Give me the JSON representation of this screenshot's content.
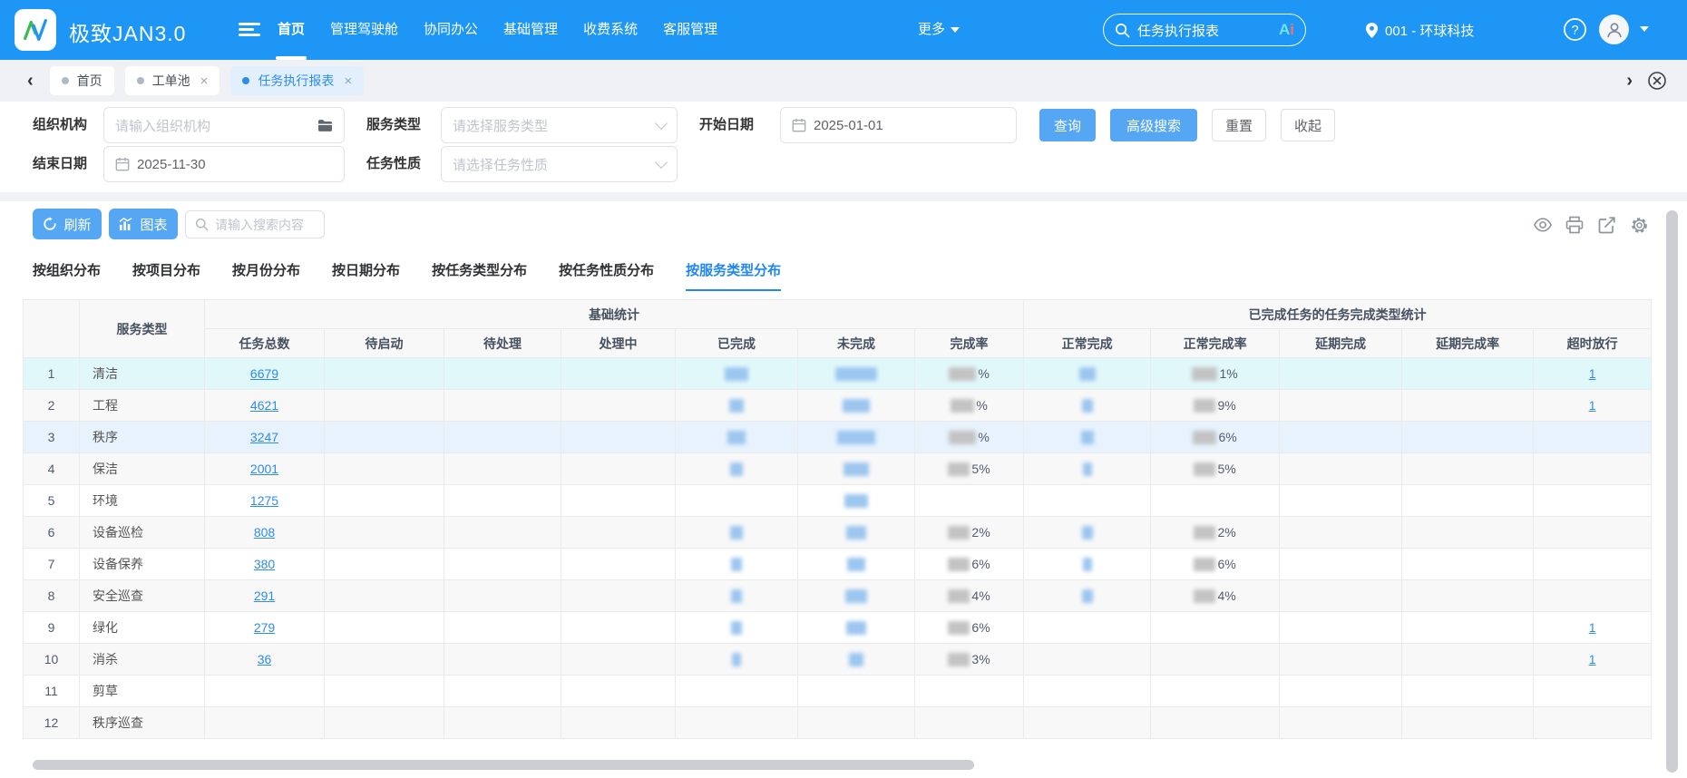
{
  "colors": {
    "header_bg": "#1e96f5",
    "button_blue": "#56a7f3",
    "link": "#2d8cf0",
    "active_tab": "#2186f0",
    "row_highlight_cyan": "#e1f8fb",
    "row_highlight_blue": "#e7f2fd"
  },
  "header": {
    "title": "极致JAN3.0",
    "nav": {
      "items": [
        "首页",
        "管理驾驶舱",
        "协同办公",
        "基础管理",
        "收费系统",
        "客服管理"
      ],
      "active_index": 0,
      "more_label": "更多"
    },
    "search": {
      "value": "任务执行报表",
      "ai_a": "A",
      "ai_i": "i"
    },
    "location": "001 - 环球科技"
  },
  "tabbar": {
    "back_glyph": "‹",
    "forward_glyph": "›",
    "tabs": [
      {
        "label": "首页",
        "closable": false,
        "active": false
      },
      {
        "label": "工单池",
        "closable": true,
        "active": false
      },
      {
        "label": "任务执行报表",
        "closable": true,
        "active": true
      }
    ],
    "close_glyph": "×"
  },
  "filters": {
    "org": {
      "label": "组织机构",
      "placeholder": "请输入组织机构"
    },
    "service": {
      "label": "服务类型",
      "placeholder": "请选择服务类型"
    },
    "start": {
      "label": "开始日期",
      "value": "2025-01-01"
    },
    "end": {
      "label": "结束日期",
      "value": "2025-11-30"
    },
    "nature": {
      "label": "任务性质",
      "placeholder": "请选择任务性质"
    },
    "buttons": {
      "query": "查询",
      "advanced": "高级搜索",
      "reset": "重置",
      "collapse": "收起"
    }
  },
  "toolbar": {
    "refresh": "刷新",
    "chart": "图表",
    "search_placeholder": "请输入搜索内容"
  },
  "dist_tabs": {
    "items": [
      "按组织分布",
      "按项目分布",
      "按月份分布",
      "按日期分布",
      "按任务类型分布",
      "按任务性质分布",
      "按服务类型分布"
    ],
    "active_index": 6
  },
  "table": {
    "service_col": "服务类型",
    "group_base": "基础统计",
    "group_completed": "已完成任务的任务完成类型统计",
    "columns": [
      "任务总数",
      "待启动",
      "待处理",
      "处理中",
      "已完成",
      "未完成",
      "完成率",
      "正常完成",
      "正常完成率",
      "延期完成",
      "延期完成率",
      "超时放行"
    ],
    "rows": [
      {
        "no": "1",
        "service": "清洁",
        "total": "6679",
        "done_w": 26,
        "undone_w": 46,
        "rate_w": 30,
        "rate_suffix": "%",
        "normal_w": 18,
        "nrate_w": 28,
        "nrate_suffix": "1%",
        "overtime": "1",
        "bg": "#e1f8fb"
      },
      {
        "no": "2",
        "service": "工程",
        "total": "4621",
        "done_w": 16,
        "undone_w": 30,
        "rate_w": 26,
        "rate_suffix": "%",
        "normal_w": 12,
        "nrate_w": 24,
        "nrate_suffix": "9%",
        "overtime": "1",
        "bg": "#f8f8f9"
      },
      {
        "no": "3",
        "service": "秩序",
        "total": "3247",
        "done_w": 20,
        "undone_w": 42,
        "rate_w": 30,
        "rate_suffix": "%",
        "normal_w": 14,
        "nrate_w": 26,
        "nrate_suffix": "6%",
        "overtime": "",
        "bg": "#e7f2fd"
      },
      {
        "no": "4",
        "service": "保洁",
        "total": "2001",
        "done_w": 14,
        "undone_w": 28,
        "rate_w": 24,
        "rate_suffix": "5%",
        "normal_w": 10,
        "nrate_w": 24,
        "nrate_suffix": "5%",
        "overtime": "",
        "bg": "#f8f8f9"
      },
      {
        "no": "5",
        "service": "环境",
        "total": "1275",
        "done_w": 0,
        "undone_w": 26,
        "rate_w": 0,
        "rate_suffix": "",
        "normal_w": 0,
        "nrate_w": 0,
        "nrate_suffix": "",
        "overtime": "",
        "bg": "#ffffff"
      },
      {
        "no": "6",
        "service": "设备巡检",
        "total": "808",
        "done_w": 14,
        "undone_w": 22,
        "rate_w": 24,
        "rate_suffix": "2%",
        "normal_w": 12,
        "nrate_w": 24,
        "nrate_suffix": "2%",
        "overtime": "",
        "bg": "#f8f8f9"
      },
      {
        "no": "7",
        "service": "设备保养",
        "total": "380",
        "done_w": 12,
        "undone_w": 20,
        "rate_w": 24,
        "rate_suffix": "6%",
        "normal_w": 10,
        "nrate_w": 24,
        "nrate_suffix": "6%",
        "overtime": "",
        "bg": "#ffffff"
      },
      {
        "no": "8",
        "service": "安全巡查",
        "total": "291",
        "done_w": 12,
        "undone_w": 24,
        "rate_w": 24,
        "rate_suffix": "4%",
        "normal_w": 12,
        "nrate_w": 24,
        "nrate_suffix": "4%",
        "overtime": "",
        "bg": "#f8f8f9"
      },
      {
        "no": "9",
        "service": "绿化",
        "total": "279",
        "done_w": 12,
        "undone_w": 22,
        "rate_w": 24,
        "rate_suffix": "6%",
        "normal_w": 0,
        "nrate_w": 0,
        "nrate_suffix": "",
        "overtime": "1",
        "bg": "#ffffff"
      },
      {
        "no": "10",
        "service": "消杀",
        "total": "36",
        "done_w": 10,
        "undone_w": 16,
        "rate_w": 24,
        "rate_suffix": "3%",
        "normal_w": 0,
        "nrate_w": 0,
        "nrate_suffix": "",
        "overtime": "1",
        "bg": "#f8f8f9"
      },
      {
        "no": "11",
        "service": "剪草",
        "total": "",
        "done_w": 0,
        "undone_w": 0,
        "rate_w": 0,
        "rate_suffix": "",
        "normal_w": 0,
        "nrate_w": 0,
        "nrate_suffix": "",
        "overtime": "",
        "bg": "#ffffff"
      },
      {
        "no": "12",
        "service": "秩序巡查",
        "total": "",
        "done_w": 0,
        "undone_w": 0,
        "rate_w": 0,
        "rate_suffix": "",
        "normal_w": 0,
        "nrate_w": 0,
        "nrate_suffix": "",
        "overtime": "",
        "bg": "#f8f8f9"
      }
    ]
  }
}
